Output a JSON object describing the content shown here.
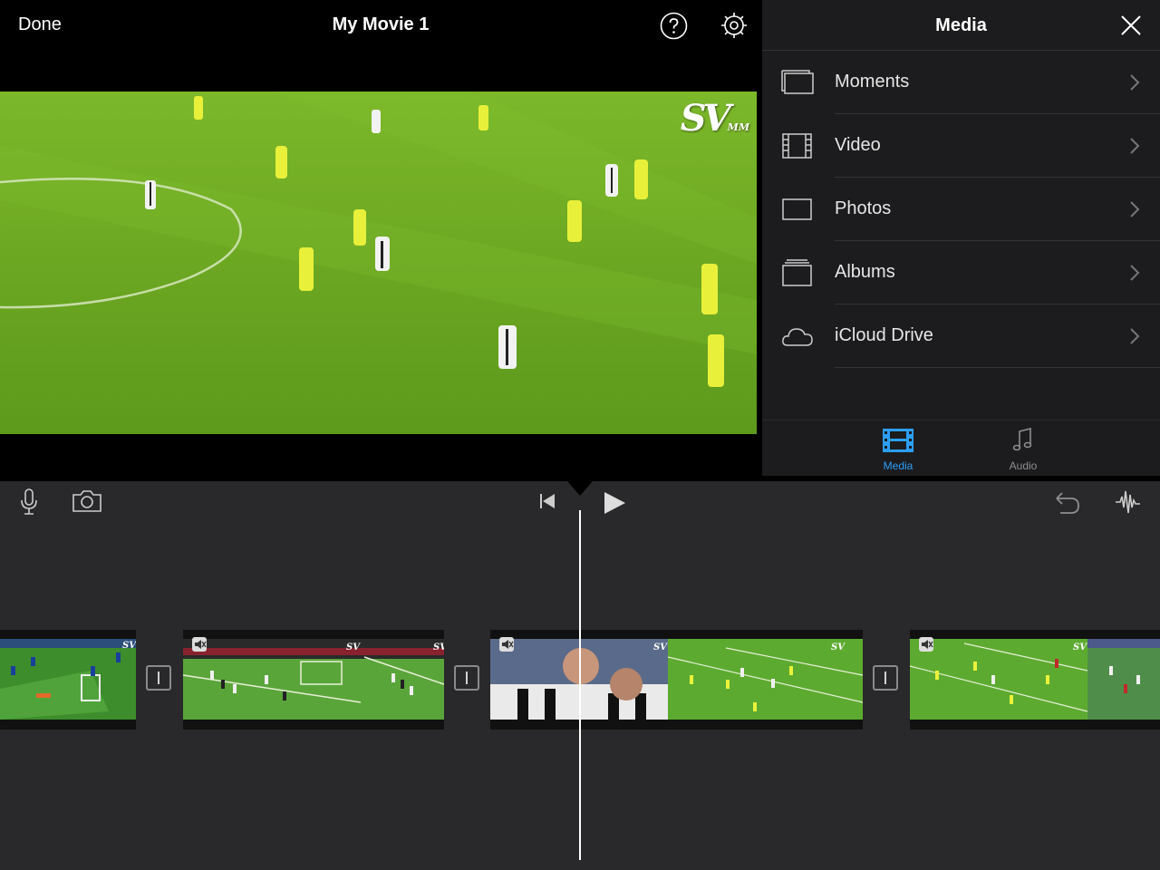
{
  "topbar": {
    "done_label": "Done",
    "project_title": "My Movie 1"
  },
  "viewer": {
    "watermark": "SV",
    "watermark_sub": "MM"
  },
  "media_panel": {
    "title": "Media",
    "items": [
      {
        "label": "Moments",
        "icon": "moments-icon"
      },
      {
        "label": "Video",
        "icon": "film-icon"
      },
      {
        "label": "Photos",
        "icon": "photo-frame-icon"
      },
      {
        "label": "Albums",
        "icon": "albums-icon"
      },
      {
        "label": "iCloud Drive",
        "icon": "cloud-icon"
      }
    ],
    "tabs": [
      {
        "label": "Media",
        "icon": "media-film-icon",
        "selected": true
      },
      {
        "label": "Audio",
        "icon": "music-note-icon",
        "selected": false
      }
    ]
  },
  "colors": {
    "accent": "#2c9ef7",
    "panel_bg": "#1c1c1e",
    "timeline_bg": "#29292b",
    "pitch_green": "#6fa824"
  }
}
